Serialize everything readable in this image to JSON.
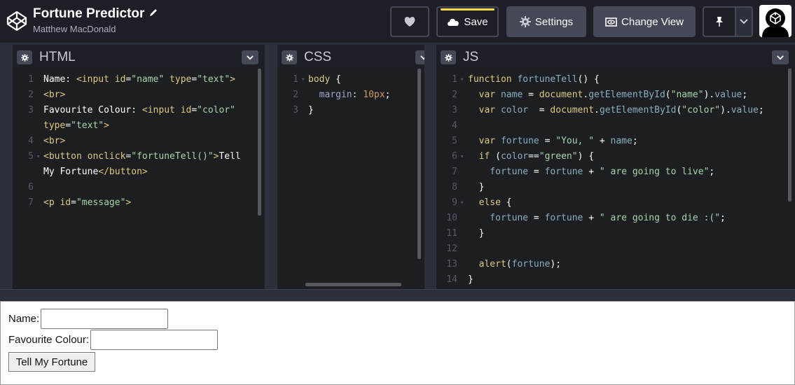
{
  "header": {
    "title": "Fortune Predictor",
    "author": "Matthew MacDonald",
    "buttons": {
      "save": "Save",
      "settings": "Settings",
      "change_view": "Change View"
    },
    "icons": [
      "codepen-logo-icon",
      "pencil-icon",
      "heart-icon",
      "cloud-icon",
      "gear-icon",
      "eye-icon",
      "pin-icon",
      "chevron-down-icon",
      "avatar"
    ]
  },
  "panels": {
    "html": {
      "title": "HTML",
      "line_numbers": [
        "1",
        "2",
        "3",
        "",
        "4",
        "5",
        "",
        "6",
        "7"
      ],
      "lines": [
        [
          [
            "tx",
            "Name: "
          ],
          [
            "tg",
            "<input "
          ],
          [
            "at",
            "id"
          ],
          [
            "pn",
            "="
          ],
          [
            "st",
            "\"name\""
          ],
          [
            "at",
            " type"
          ],
          [
            "pn",
            "="
          ],
          [
            "st",
            "\"text\""
          ],
          [
            "tg",
            ">"
          ]
        ],
        [
          [
            "tg",
            "<br>"
          ]
        ],
        [
          [
            "tx",
            "Favourite Colour: "
          ],
          [
            "tg",
            "<input "
          ],
          [
            "at",
            "id"
          ],
          [
            "pn",
            "="
          ],
          [
            "st",
            "\"color\""
          ]
        ],
        [
          [
            "at",
            "type"
          ],
          [
            "pn",
            "="
          ],
          [
            "st",
            "\"text\""
          ],
          [
            "tg",
            ">"
          ]
        ],
        [
          [
            "tg",
            "<br>"
          ]
        ],
        [
          [
            "tg",
            "<button "
          ],
          [
            "at",
            "onclick"
          ],
          [
            "pn",
            "="
          ],
          [
            "st",
            "\"fortuneTell()\""
          ],
          [
            "tg",
            ">"
          ],
          [
            "tx",
            "Tell"
          ]
        ],
        [
          [
            "tx",
            "My Fortune"
          ],
          [
            "tg",
            "</button>"
          ]
        ],
        [
          [
            "tx",
            ""
          ]
        ],
        [
          [
            "tg",
            "<p "
          ],
          [
            "at",
            "id"
          ],
          [
            "pn",
            "="
          ],
          [
            "st",
            "\"message\""
          ],
          [
            "tg",
            ">"
          ]
        ]
      ]
    },
    "css": {
      "title": "CSS",
      "line_numbers": [
        "1",
        "2",
        "3"
      ],
      "lines": [
        [
          [
            "tg",
            "body "
          ],
          [
            "pn",
            "{"
          ]
        ],
        [
          [
            "pr",
            "  margin"
          ],
          [
            "pn",
            ": "
          ],
          [
            "nm",
            "10px"
          ],
          [
            "pn",
            ";"
          ]
        ],
        [
          [
            "pn",
            "}"
          ]
        ]
      ]
    },
    "js": {
      "title": "JS",
      "line_numbers": [
        "1",
        "2",
        "3",
        "4",
        "5",
        "6",
        "7",
        "8",
        "9",
        "10",
        "11",
        "12",
        "13",
        "14"
      ],
      "lines": [
        [
          [
            "kw",
            "function "
          ],
          [
            "vr",
            "fortuneTell"
          ],
          [
            "pn",
            "() {"
          ]
        ],
        [
          [
            "kw",
            "  var "
          ],
          [
            "vr",
            "name"
          ],
          [
            "pn",
            " = "
          ],
          [
            "kw",
            "document"
          ],
          [
            "pn",
            "."
          ],
          [
            "vr",
            "getElementById"
          ],
          [
            "pn",
            "("
          ],
          [
            "st",
            "\"name\""
          ],
          [
            "pn",
            ")."
          ],
          [
            "vr",
            "value"
          ],
          [
            "pn",
            ";"
          ]
        ],
        [
          [
            "kw",
            "  var "
          ],
          [
            "vr",
            "color"
          ],
          [
            "pn",
            "  = "
          ],
          [
            "kw",
            "document"
          ],
          [
            "pn",
            "."
          ],
          [
            "vr",
            "getElementById"
          ],
          [
            "pn",
            "("
          ],
          [
            "st",
            "\"color\""
          ],
          [
            "pn",
            ")."
          ],
          [
            "vr",
            "value"
          ],
          [
            "pn",
            ";"
          ]
        ],
        [
          [
            "tx",
            ""
          ]
        ],
        [
          [
            "kw",
            "  var "
          ],
          [
            "vr",
            "fortune"
          ],
          [
            "pn",
            " = "
          ],
          [
            "st",
            "\"You, \""
          ],
          [
            "pn",
            " + "
          ],
          [
            "vr",
            "name"
          ],
          [
            "pn",
            ";"
          ]
        ],
        [
          [
            "kw",
            "  if "
          ],
          [
            "pn",
            "("
          ],
          [
            "vr",
            "color"
          ],
          [
            "pn",
            "=="
          ],
          [
            "st",
            "\"green\""
          ],
          [
            "pn",
            ") {"
          ]
        ],
        [
          [
            "vr",
            "    fortune"
          ],
          [
            "pn",
            " = "
          ],
          [
            "vr",
            "fortune"
          ],
          [
            "pn",
            " + "
          ],
          [
            "st",
            "\" are going to live\""
          ],
          [
            "pn",
            ";"
          ]
        ],
        [
          [
            "pn",
            "  }"
          ]
        ],
        [
          [
            "kw",
            "  else "
          ],
          [
            "pn",
            "{"
          ]
        ],
        [
          [
            "vr",
            "    fortune"
          ],
          [
            "pn",
            " = "
          ],
          [
            "vr",
            "fortune"
          ],
          [
            "pn",
            " + "
          ],
          [
            "st",
            "\" are going to die :(\""
          ],
          [
            "pn",
            ";"
          ]
        ],
        [
          [
            "pn",
            "  }"
          ]
        ],
        [
          [
            "tx",
            ""
          ]
        ],
        [
          [
            "kw",
            "  alert"
          ],
          [
            "pn",
            "("
          ],
          [
            "vr",
            "fortune"
          ],
          [
            "pn",
            ");"
          ]
        ],
        [
          [
            "pn",
            "}"
          ]
        ]
      ]
    }
  },
  "preview": {
    "name_label": "Name:",
    "color_label": "Favourite Colour:",
    "button_label": "Tell My Fortune"
  }
}
